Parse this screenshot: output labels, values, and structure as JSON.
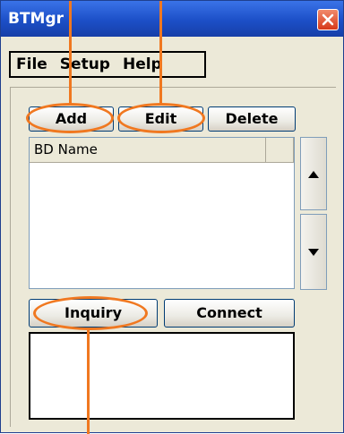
{
  "window": {
    "title": "BTMgr"
  },
  "menu": {
    "items": [
      "File",
      "Setup",
      "Help"
    ]
  },
  "toolbar": {
    "add_label": "Add",
    "edit_label": "Edit",
    "delete_label": "Delete"
  },
  "device_list": {
    "columns": [
      "BD Name",
      ""
    ]
  },
  "actions": {
    "inquiry_label": "Inquiry",
    "connect_label": "Connect"
  },
  "colors": {
    "titlebar": "#245edb",
    "callout": "#f07820",
    "window_bg": "#ece9d8"
  },
  "icons": {
    "close": "close-icon",
    "scroll_up": "arrow-up-icon",
    "scroll_down": "arrow-down-icon"
  }
}
